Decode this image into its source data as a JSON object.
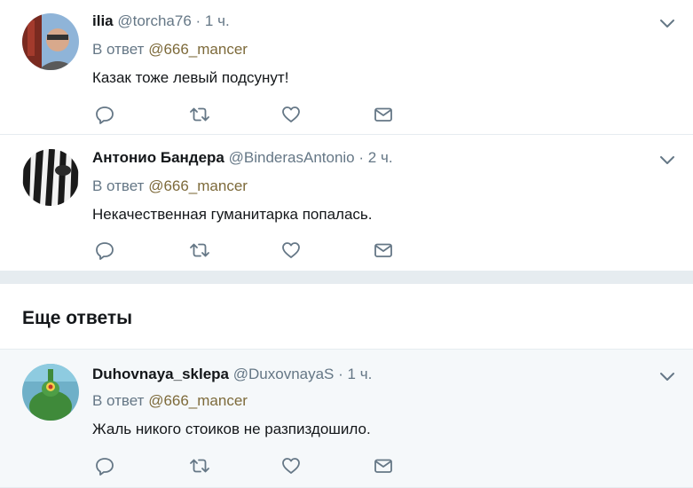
{
  "reply_prefix": "В ответ",
  "more_replies_title": "Еще ответы",
  "tweets": [
    {
      "name": "ilia",
      "handle": "@torcha76",
      "separator": "·",
      "time": "1 ч.",
      "reply_to": "@666_mancer",
      "text": "Казак тоже левый подсунут!"
    },
    {
      "name": "Антонио Бандера",
      "handle": "@BinderasAntonio",
      "separator": "·",
      "time": "2 ч.",
      "reply_to": "@666_mancer",
      "text": "Некачественная гуманитарка попалась."
    },
    {
      "name": "Duhovnaya_sklepa",
      "handle": "@DuxovnayaS",
      "separator": "·",
      "time": "1 ч.",
      "reply_to": "@666_mancer",
      "text": "Жаль никого стоиков не разпиздошило."
    }
  ],
  "icons": {
    "reply": "reply-icon",
    "retweet": "retweet-icon",
    "like": "heart-icon",
    "dm": "envelope-icon",
    "menu": "chevron-down-icon"
  },
  "colors": {
    "icon": "#657786",
    "mention": "#7d6a3a",
    "page_bg": "#e6ecf0",
    "highlight_bg": "#f5f8fa"
  }
}
